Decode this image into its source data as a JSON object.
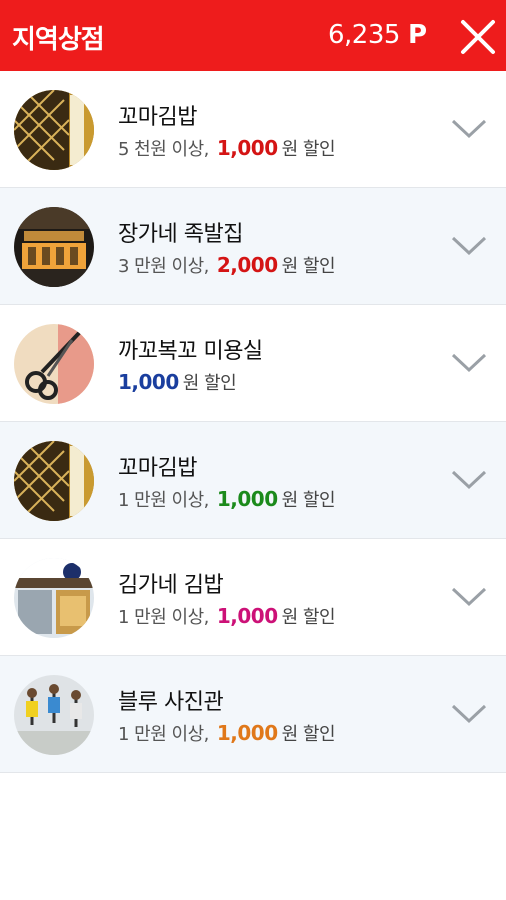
{
  "header": {
    "title": "지역상점",
    "points": "6,235",
    "points_unit": "P",
    "close_icon": "close-icon",
    "color": "#ee1c1c"
  },
  "stores": [
    {
      "name": "꼬마김밥",
      "condition": "5 천원 이상,",
      "amount": "1,000",
      "suffix": "원 할인",
      "amount_color": "#d41414",
      "thumb": "kimbap-shop-photo"
    },
    {
      "name": "장가네 족발집",
      "condition": "3 만원 이상,",
      "amount": "2,000",
      "suffix": "원 할인",
      "amount_color": "#d41414",
      "thumb": "jokbal-shop-photo"
    },
    {
      "name": "까꼬복꼬 미용실",
      "condition": "",
      "amount": "1,000",
      "suffix": "원 할인",
      "amount_color": "#1a3e9e",
      "thumb": "scissors-photo"
    },
    {
      "name": "꼬마김밥",
      "condition": "1 만원 이상,",
      "amount": "1,000",
      "suffix": "원 할인",
      "amount_color": "#1b8a1b",
      "thumb": "kimbap-shop-photo"
    },
    {
      "name": "김가네 김밥",
      "condition": "1 만원 이상,",
      "amount": "1,000",
      "suffix": "원 할인",
      "amount_color": "#cc1177",
      "thumb": "kimbap-storefront-photo"
    },
    {
      "name": "블루 사진관",
      "condition": "1 만원 이상,",
      "amount": "1,000",
      "suffix": "원 할인",
      "amount_color": "#e0781a",
      "thumb": "jumping-people-photo"
    }
  ],
  "row_icon": "chevron-down-icon"
}
